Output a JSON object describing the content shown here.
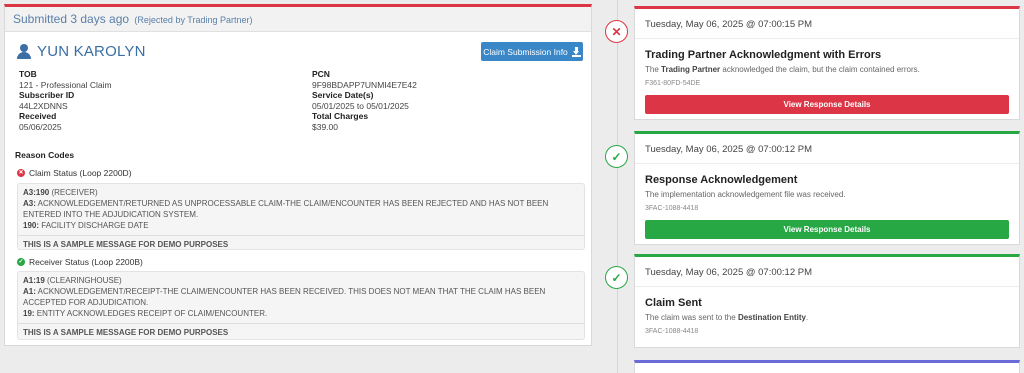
{
  "submission": {
    "submitted": "Submitted 3 days ago",
    "rejected_note": "(Rejected by Trading Partner)"
  },
  "patient": {
    "name": "YUN KAROLYN",
    "info_button": "Claim Submission Info"
  },
  "fields_left": [
    {
      "label": "TOB",
      "value": "121 - Professional Claim"
    },
    {
      "label": "Subscriber ID",
      "value": "44L2XDNNS"
    },
    {
      "label": "Received",
      "value": "05/06/2025"
    }
  ],
  "fields_right": [
    {
      "label": "PCN",
      "value": "9F98BDAPP7UNMI4E7E42"
    },
    {
      "label": "Service Date(s)",
      "value": "05/01/2025 to 05/01/2025"
    },
    {
      "label": "Total Charges",
      "value": "$39.00"
    }
  ],
  "reason": {
    "title": "Reason Codes",
    "claim_status": {
      "label": "Claim Status (Loop 2200D)",
      "code_line": "A3:190",
      "code_note": "(RECEIVER)",
      "a_code": "A3:",
      "a_text": "ACKNOWLEDGEMENT/RETURNED AS UNPROCESSABLE CLAIM-THE CLAIM/ENCOUNTER HAS BEEN REJECTED AND HAS NOT BEEN ENTERED INTO THE ADJUDICATION SYSTEM.",
      "b_code": "190:",
      "b_text": "FACILITY DISCHARGE DATE",
      "sample": "THIS IS A SAMPLE MESSAGE FOR DEMO PURPOSES"
    },
    "receiver_status": {
      "label": "Receiver Status (Loop 2200B)",
      "code_line": "A1:19",
      "code_note": "(CLEARINGHOUSE)",
      "a_code": "A1:",
      "a_text": "ACKNOWLEDGEMENT/RECEIPT-THE CLAIM/ENCOUNTER HAS BEEN RECEIVED. THIS DOES NOT MEAN THAT THE CLAIM HAS BEEN ACCEPTED FOR ADJUDICATION.",
      "b_code": "19:",
      "b_text": "ENTITY ACKNOWLEDGES RECEIPT OF CLAIM/ENCOUNTER.",
      "sample": "THIS IS A SAMPLE MESSAGE FOR DEMO PURPOSES"
    }
  },
  "timeline": [
    {
      "date": "Tuesday, May 06, 2025 @ 07:00:15 PM",
      "title": "Trading Partner Acknowledgment with Errors",
      "desc_pre": "The",
      "desc_bold": "Trading Partner",
      "desc_post": "acknowledged the claim, but the claim contained errors.",
      "id": "F361-80FD-54DE",
      "button": "View Response Details",
      "status": "error"
    },
    {
      "date": "Tuesday, May 06, 2025 @ 07:00:12 PM",
      "title": "Response Acknowledgement",
      "desc_pre": "The implementation acknowledgement file was received.",
      "id": "3FAC-1088-4418",
      "button": "View Response Details",
      "status": "ok"
    },
    {
      "date": "Tuesday, May 06, 2025 @ 07:00:12 PM",
      "title": "Claim Sent",
      "desc_pre": "The claim was sent to the",
      "desc_bold": "Destination Entity",
      "desc_post": ".",
      "id": "3FAC-1088-4418",
      "status": "ok"
    }
  ],
  "colors": {
    "error": "#dc3545",
    "success": "#28a745",
    "primary": "#3a87c8",
    "pending": "#6a6ad8"
  }
}
